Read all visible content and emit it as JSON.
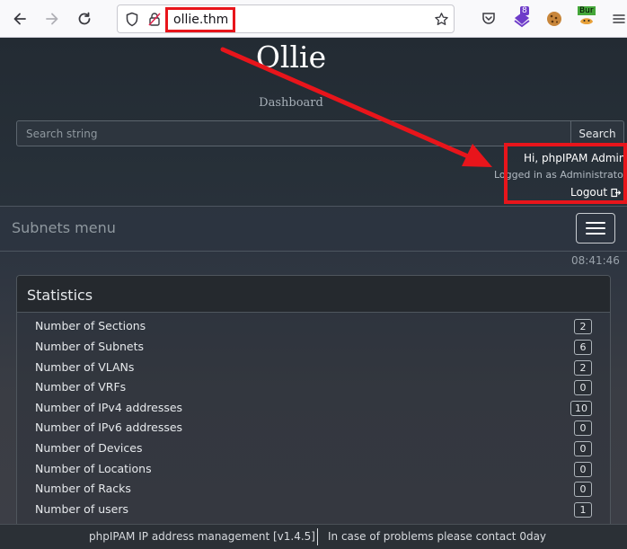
{
  "browser": {
    "url": "ollie.thm",
    "toolbar_badge": "8",
    "burp_label": "Bur"
  },
  "header": {
    "title": "Ollie",
    "subtitle": "Dashboard",
    "search_placeholder": "Search string",
    "search_button": "Search"
  },
  "user": {
    "greeting": "Hi, phpIPAM Admin",
    "logged_in_as": "Logged in as  Administrator",
    "logout": "Logout"
  },
  "subnets_menu": {
    "title": "Subnets menu"
  },
  "clock": "08:41:46",
  "statistics": {
    "title": "Statistics",
    "rows": [
      {
        "label": "Number of Sections",
        "value": "2"
      },
      {
        "label": "Number of Subnets",
        "value": "6"
      },
      {
        "label": "Number of VLANs",
        "value": "2"
      },
      {
        "label": "Number of VRFs",
        "value": "0"
      },
      {
        "label": "Number of IPv4 addresses",
        "value": "10"
      },
      {
        "label": "Number of IPv6 addresses",
        "value": "0"
      },
      {
        "label": "Number of Devices",
        "value": "0"
      },
      {
        "label": "Number of Locations",
        "value": "0"
      },
      {
        "label": "Number of Racks",
        "value": "0"
      },
      {
        "label": "Number of users",
        "value": "1"
      }
    ]
  },
  "footer": {
    "left": "phpIPAM IP address management [v1.4.5]",
    "right": "In case of problems please contact 0day"
  },
  "colors": {
    "annotation_red": "#e8151b",
    "page_bg": "#2b333c",
    "text_light": "#e6e9ec"
  }
}
